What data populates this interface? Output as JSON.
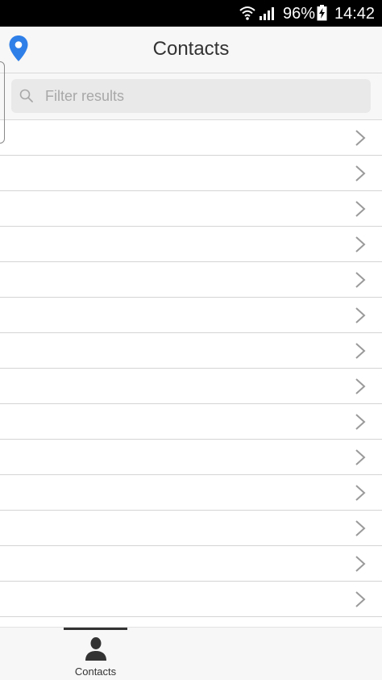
{
  "status_bar": {
    "battery_percent": "96%",
    "time": "14:42",
    "icons": [
      "wifi-icon",
      "signal-icon",
      "battery-charging-icon"
    ]
  },
  "header": {
    "title": "Contacts",
    "left_icon": "location-pin-icon",
    "accent_color": "#2f7fe8"
  },
  "search": {
    "placeholder": "Filter results",
    "value": ""
  },
  "contact_list": {
    "items": [
      {
        "label": ""
      },
      {
        "label": ""
      },
      {
        "label": ""
      },
      {
        "label": ""
      },
      {
        "label": ""
      },
      {
        "label": ""
      },
      {
        "label": ""
      },
      {
        "label": ""
      },
      {
        "label": ""
      },
      {
        "label": ""
      },
      {
        "label": ""
      },
      {
        "label": ""
      },
      {
        "label": ""
      },
      {
        "label": ""
      },
      {
        "label": ""
      }
    ]
  },
  "tab_bar": {
    "tabs": [
      {
        "label": "Contacts",
        "icon": "person-icon",
        "active": true
      }
    ]
  }
}
